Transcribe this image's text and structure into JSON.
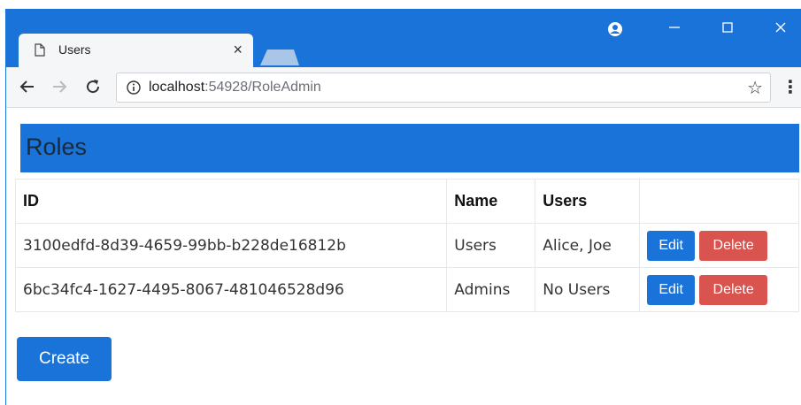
{
  "browser": {
    "tab_title": "Users",
    "tab_close": "×",
    "address": {
      "host": "localhost",
      "rest": ":54928/RoleAdmin"
    },
    "icons": {
      "back": "arrow-left-icon",
      "forward": "arrow-right-icon",
      "reload": "reload-icon",
      "info": "info-icon",
      "star": "star-icon",
      "menu": "kebab-menu-icon",
      "profile": "profile-icon",
      "minimize": "minimize-icon",
      "maximize": "maximize-icon",
      "close": "close-icon"
    },
    "colors": {
      "accent": "#1a73d8"
    }
  },
  "page": {
    "title": "Roles",
    "table": {
      "headers": [
        "ID",
        "Name",
        "Users",
        ""
      ],
      "rows": [
        {
          "id": "3100edfd-8d39-4659-99bb-b228de16812b",
          "name": "Users",
          "users": "Alice, Joe",
          "edit": "Edit",
          "delete": "Delete"
        },
        {
          "id": "6bc34fc4-1627-4495-8067-481046528d96",
          "name": "Admins",
          "users": "No Users",
          "edit": "Edit",
          "delete": "Delete"
        }
      ]
    },
    "create_label": "Create",
    "colors": {
      "primary": "#1a73d8",
      "danger": "#d9534f"
    }
  }
}
